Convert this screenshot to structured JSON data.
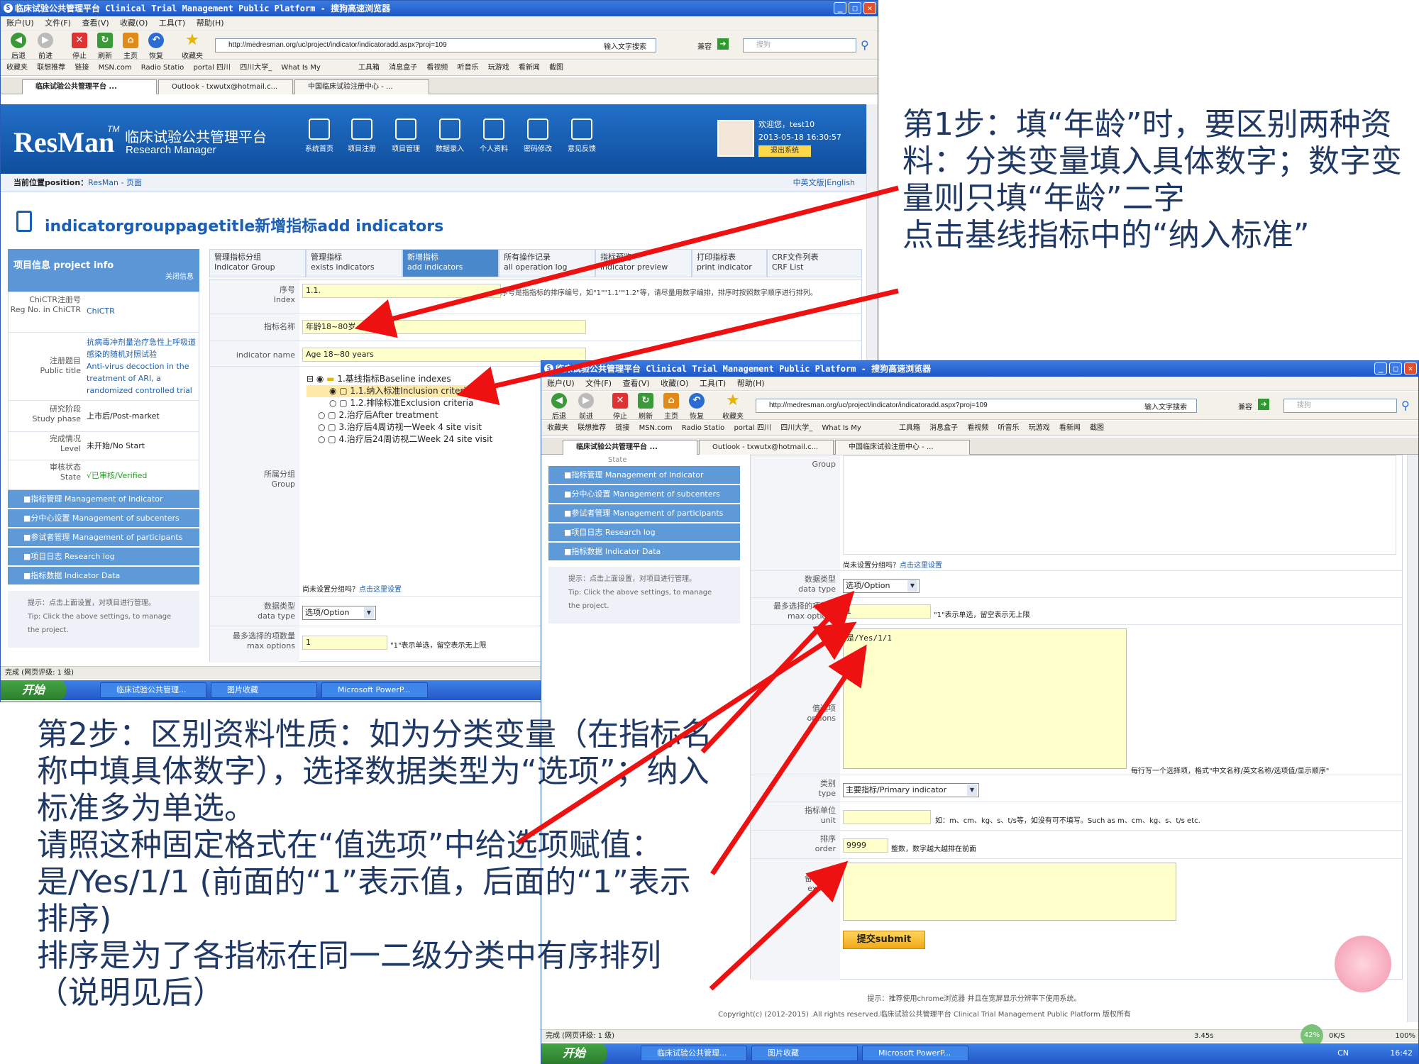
{
  "w1": {
    "title": "临床试验公共管理平台 Clinical Trial Management Public Platform - 搜狗高速浏览器",
    "menu": [
      "账户(U)",
      "文件(F)",
      "查看(V)",
      "收藏(O)",
      "工具(T)",
      "帮助(H)"
    ],
    "tools": [
      "后退",
      "前进",
      "停止",
      "刷新",
      "主页",
      "恢复",
      "收藏夹"
    ],
    "url": "http://medresman.org/uc/project/indicator/indicatoradd.aspx?proj=109",
    "search_label": "输入文字搜索",
    "compat": "兼容",
    "search_placeholder": "搜狗",
    "favs": [
      "收藏夹",
      "联想推荐",
      "链接",
      "MSN.com",
      "Radio Statio",
      "portal 四川",
      "四川大学_",
      "What Is My"
    ],
    "favs_right": [
      "工具箱",
      "消息盒子",
      "看视频",
      "听音乐",
      "玩游戏",
      "看新闻",
      "截图"
    ],
    "tabs": [
      "临床试验公共管理平台 ...",
      "Outlook - txwutx@hotmail.c...",
      "中国临床试验注册中心 - ..."
    ],
    "brand": "ResMan",
    "tm": "TM",
    "brand_cn": "临床试验公共管理平台",
    "brand_en": "Research Manager",
    "nav": [
      "系统首页",
      "项目注册",
      "项目管理",
      "数据录入",
      "个人资料",
      "密码修改",
      "意见反馈"
    ],
    "welcome": "欢迎您，test10",
    "datetime": "2013-05-18 16:30:57",
    "logout": "退出系统",
    "crumb_label": "当前位置position：",
    "crumb_link": "ResMan - 页面",
    "lang": "中英文版|English",
    "page_title": "indicatorgrouppagetitle新增指标add indicators",
    "proj_header": "项目信息  project info",
    "close_info": "关闭信息",
    "info": [
      {
        "label": "ChiCTR注册号\nReg No. in ChiCTR",
        "value": "ChiCTR"
      },
      {
        "label": "注册题目\nPublic title",
        "value": "抗病毒冲剂量治疗急性上呼吸道感染的随机对照试验\nAnti-virus decoction in the treatment of ARI, a randomized controlled trial"
      },
      {
        "label": "研究阶段\nStudy phase",
        "value": "上市后/Post-market"
      },
      {
        "label": "完成情况\nLevel",
        "value": "未开始/No Start"
      },
      {
        "label": "审核状态\nState",
        "value": "√已审核/Verified"
      }
    ],
    "side": [
      "■指标管理  Management of Indicator",
      "■分中心设置  Management of subcenters",
      "■参试者管理  Management of participants",
      "■项目日志  Research log",
      "■指标数据  Indicator Data"
    ],
    "tip": "提示：点击上面设置，对项目进行管理。\nTip: Click the above settings, to manage the project.",
    "ftabs": [
      "管理指标分组\nIndicator Group",
      "管理指标\nexists indicators",
      "新增指标\nadd indicators",
      "所有操作记录\nall operation log",
      "指标预览\nindicator preview",
      "打印指标表\nprint indicator",
      "CRF文件列表\nCRF List"
    ],
    "index_label": "序号\nIndex",
    "index_value": "1.1.",
    "index_hint": "序号是指指标的排序编号，如\"1\"\"1.1\"\"1.2\"等，请尽量用数字编排，排序时按照数字顺序进行排列。",
    "name_label": "指标名称",
    "name_value": "年龄18~80岁",
    "iname_label": "indicator name",
    "iname_value": "Age 18~80 years",
    "group_label": "所属分组\nGroup",
    "tree": [
      "1.基线指标Baseline indexes",
      "1.1.纳入标准Inclusion criteria",
      "1.2.排除标准Exclusion criteria",
      "2.治疗后After treatment",
      "3.治疗后4周访视一Week 4 site visit",
      "4.治疗后24周访视二Week 24 site visit"
    ],
    "nogroup": "尚未设置分组吗？",
    "nogroup_link": "点击这里设置",
    "dtype_label": "数据类型\ndata type",
    "dtype_value": "选项/Option",
    "maxopt_label": "最多选择的项数量\nmax options",
    "maxopt_value": "1",
    "maxopt_hint": "\"1\"表示单选，留空表示无上限",
    "status": "完成 (网页评级: 1 级)",
    "taskbar": {
      "start": "开始",
      "tasks": [
        "临床试验公共管理...",
        "图片收藏",
        "Microsoft PowerP..."
      ]
    }
  },
  "w2": {
    "state_cut": "State",
    "group_cut": "Group",
    "nogroup": "尚未设置分组吗？",
    "nogroup_link": "点击这里设置",
    "dtype_label": "数据类型\ndata type",
    "dtype_value": "选项/Option",
    "maxopt_label": "最多选择的项数量\nmax options",
    "maxopt_value": "1",
    "maxopt_hint": "\"1\"表示单选，留空表示无上限",
    "vals_label": "值选项\noptions",
    "vals_value": "是/Yes/1/1",
    "vals_hint": "每行写一个选择项，格式\"中文名称/英文名称/选项值/显示顺序\"",
    "cat_label": "类别\ntype",
    "cat_value": "主要指标/Primary indicator",
    "unit_label": "指标单位\nunit",
    "unit_hint": "如：m、cm、kg、s、t/s等，如没有可不填写。Such as m、cm、kg、s、t/s etc.",
    "order_label": "排序\norder",
    "order_value": "9999",
    "order_hint": "整数，数字越大越排在前面",
    "explain_label": "备注说明\nexplain",
    "submit": "提交submit",
    "footer_tip": "提示：推荐使用chrome浏览器 并且在宽屏显示分辨率下使用系统。",
    "copyright": "Copyright(c) (2012-2015) .All rights reserved.临床试验公共管理平台  Clinical Trial Management Public Platform 版权所有",
    "status": "完成 (网页评级: 1 级)",
    "status_right": "3.45s",
    "zoom": "100%",
    "net": "42%",
    "kbs": "0K/S",
    "clock": "16:42",
    "ime": "CN"
  },
  "notes": {
    "step1": "第1步：填“年龄”时，要区别两种资料：分类变量填入具体数字；数字变量则只填“年龄”二字\n点击基线指标中的“纳入标准”",
    "step2": "第2步：区别资料性质：如为分类变量（在指标名称中填具体数字），选择数据类型为“选项”；纳入标准多为单选。\n请照这种固定格式在“值选项”中给选项赋值：是/Yes/1/1 (前面的“1”表示值，后面的“1”表示排序)\n排序是为了各指标在同一二级分类中有序排列（说明见后）"
  },
  "colors": {
    "banner": "#1a5fb4",
    "arrow": "#ee1111",
    "note_text": "#1f3864",
    "input_bg": "#ffffcc",
    "side": "#5f9ad8"
  }
}
